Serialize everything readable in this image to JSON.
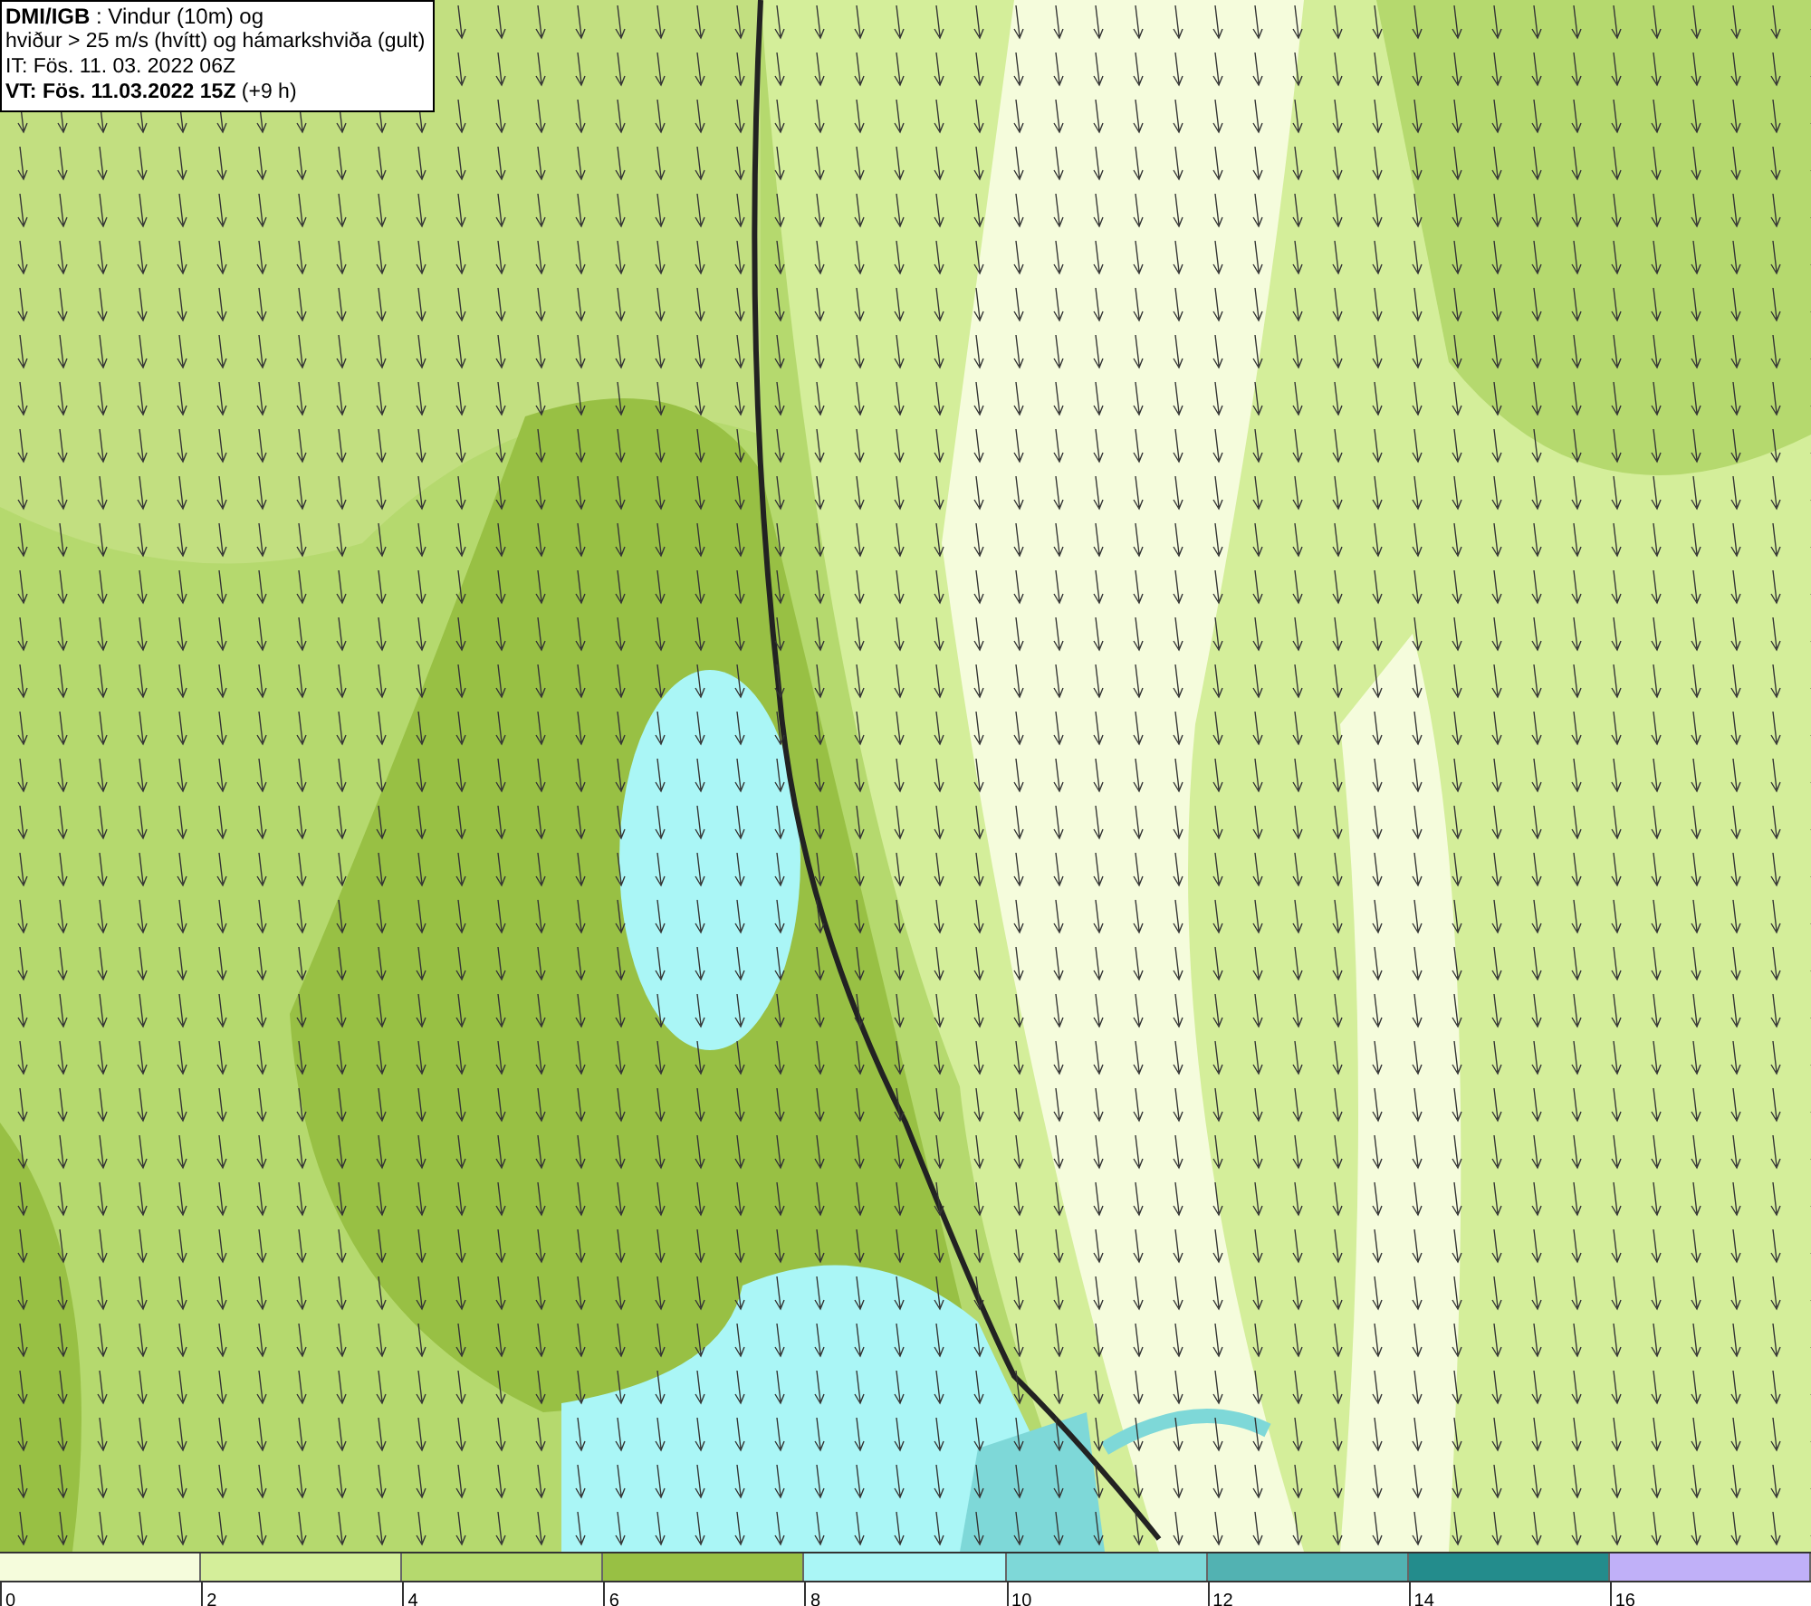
{
  "info_box": {
    "lines": [
      "**DMI/IGB** : Vindur (10m) og",
      "hviður > 25 m/s (hvítt) og hámarkshviða (gult)",
      "IT: Fös. 11. 03. 2022 06Z",
      "**VT: Fös. 11.03.2022 15Z** (+9 h)"
    ]
  },
  "legend": {
    "segments": [
      {
        "color": "#f5fcdc"
      },
      {
        "color": "#d4ee9a"
      },
      {
        "color": "#b5d96e"
      },
      {
        "color": "#98c044"
      },
      {
        "color": "#aaf6f6"
      },
      {
        "color": "#7ed8d8"
      },
      {
        "color": "#52b2b2"
      },
      {
        "color": "#238c8c"
      },
      {
        "color": "#c0b0f8"
      }
    ],
    "ticks": [
      "0",
      "2",
      "4",
      "6",
      "8",
      "10",
      "12",
      "14",
      "16"
    ]
  }
}
